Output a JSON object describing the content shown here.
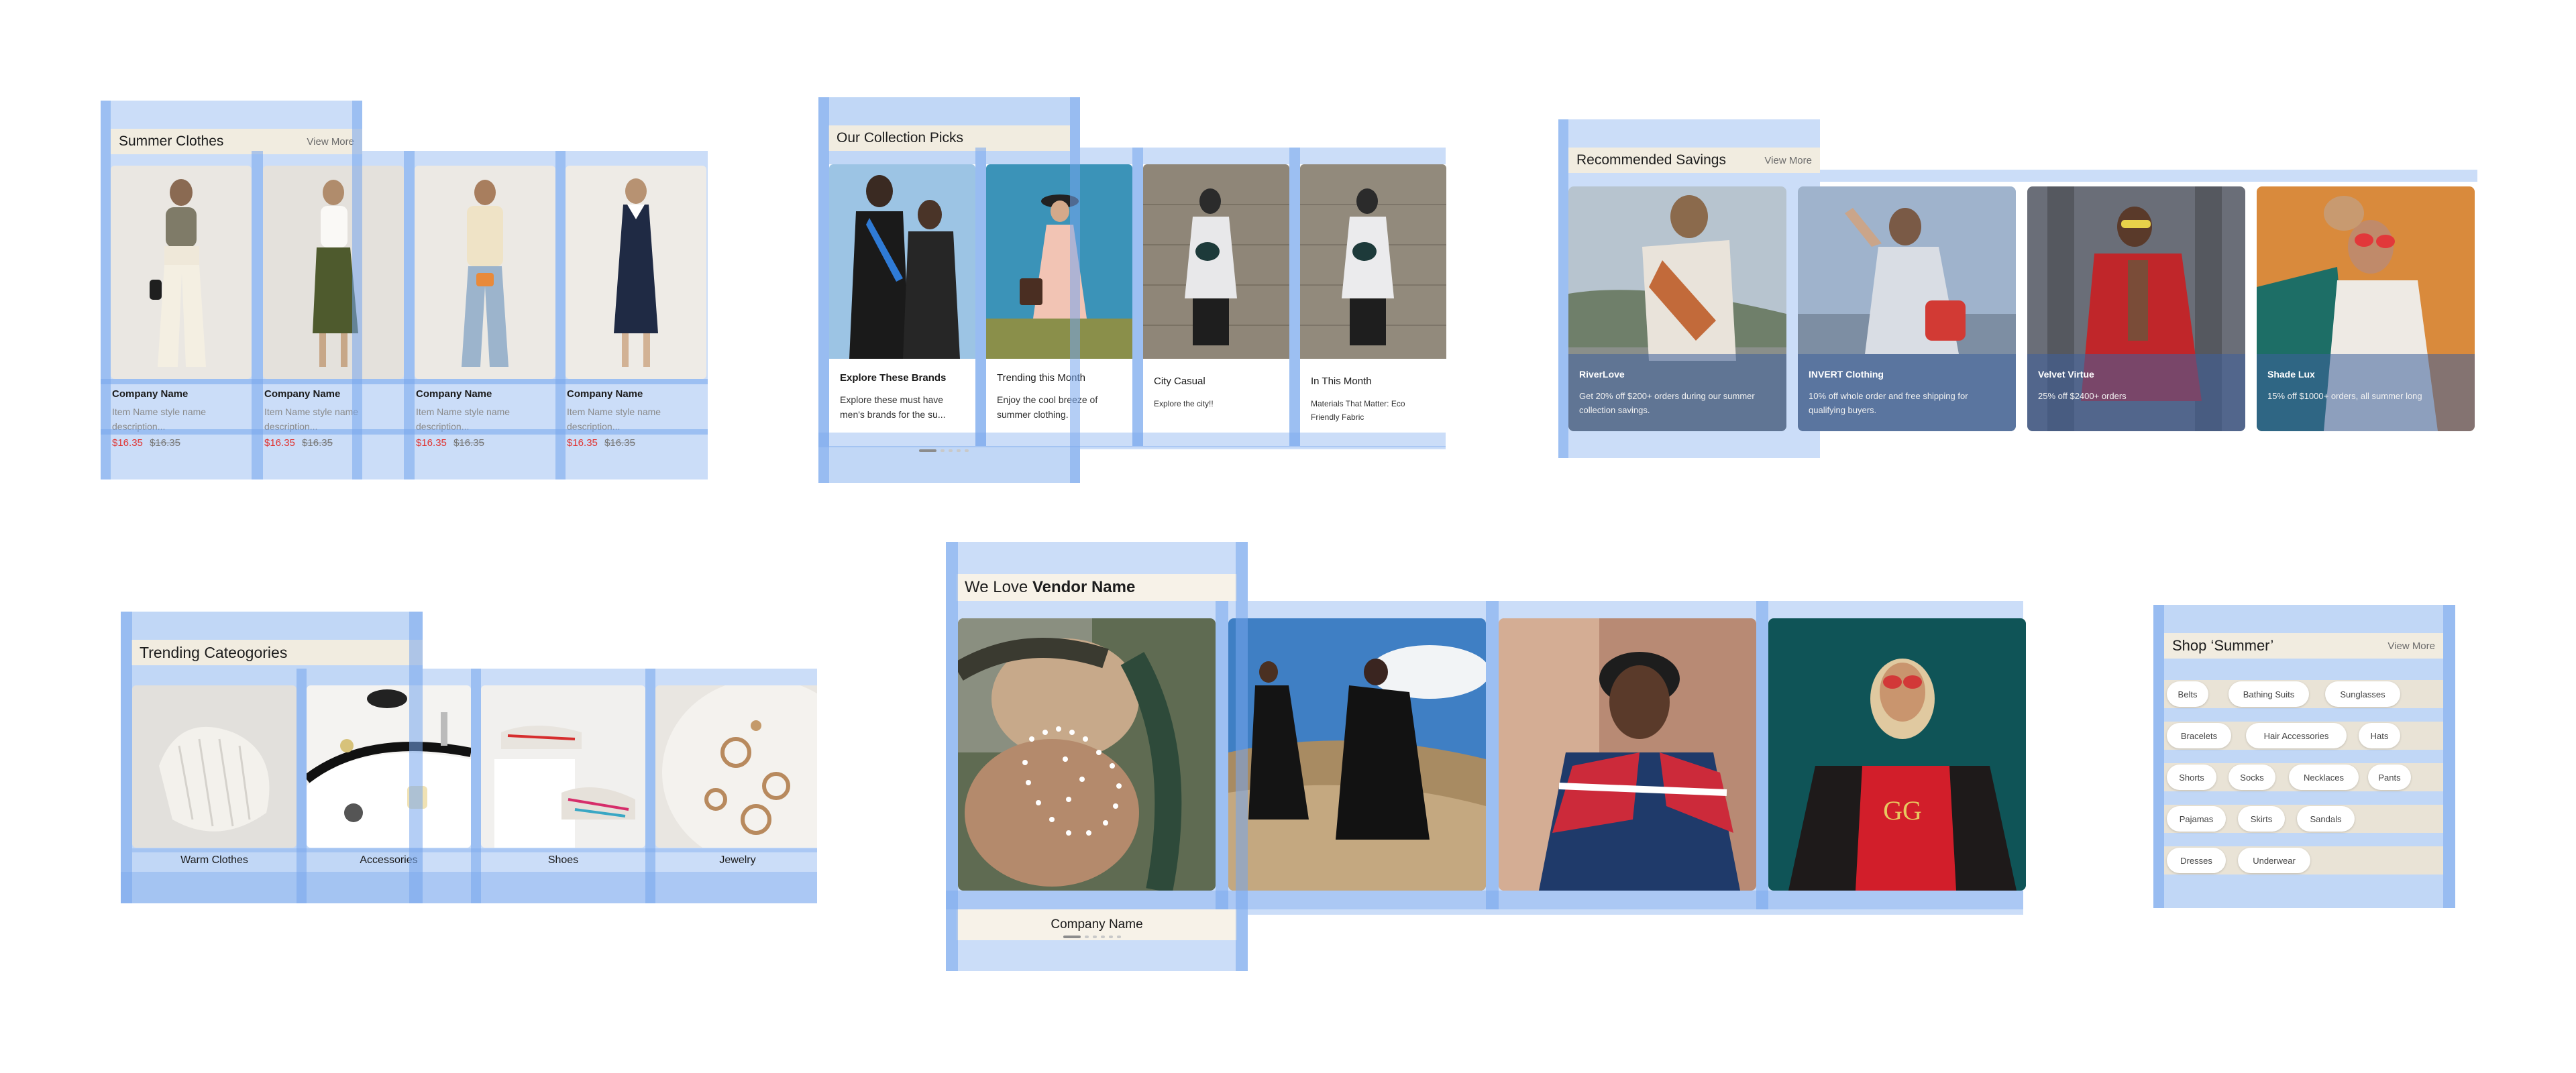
{
  "summer": {
    "title": "Summer Clothes",
    "view_more": "View More",
    "products": [
      {
        "company": "Company Name",
        "desc": "Item Name style name description...",
        "price": "$16.35",
        "old_price": "$16.35"
      },
      {
        "company": "Company Name",
        "desc": "Item Name style name description...",
        "price": "$16.35",
        "old_price": "$16.35"
      },
      {
        "company": "Company Name",
        "desc": "Item Name style name description...",
        "price": "$16.35",
        "old_price": "$16.35"
      },
      {
        "company": "Company Name",
        "desc": "Item Name style name description...",
        "price": "$16.35",
        "old_price": "$16.35"
      }
    ]
  },
  "collection": {
    "title": "Our Collection Picks",
    "cards": [
      {
        "title": "Explore These Brands",
        "desc": "Explore these must have men's brands for the su..."
      },
      {
        "title": "Trending this Month",
        "desc": "Enjoy the cool breeze of summer clothing."
      },
      {
        "title": "City Casual",
        "desc": "Explore the city!!"
      },
      {
        "title": "In This Month",
        "desc": "Materials That Matter: Eco Friendly Fabric"
      }
    ]
  },
  "savings": {
    "title": "Recommended Savings",
    "view_more": "View More",
    "cards": [
      {
        "brand": "RiverLove",
        "offer": "Get 20% off $200+ orders during our summer collection savings."
      },
      {
        "brand": "INVERT Clothing",
        "offer": "10% off whole order and free shipping for qualifying buyers."
      },
      {
        "brand": "Velvet Virtue",
        "offer": "25% off $2400+ orders"
      },
      {
        "brand": "Shade Lux",
        "offer": "15% off $1000+ orders, all summer long"
      }
    ]
  },
  "trending": {
    "title": "Trending Cateogories",
    "categories": [
      "Warm Clothes",
      "Accessories",
      "Shoes",
      "Jewelry"
    ]
  },
  "vendor": {
    "title_prefix": "We Love",
    "title_bold": "Vendor Name",
    "company": "Company Name"
  },
  "shop": {
    "title": "Shop ‘Summer’",
    "view_more": "View More",
    "chips": [
      [
        "Belts",
        "Bathing Suits",
        "Sunglasses"
      ],
      [
        "Bracelets",
        "Hair Accessories",
        "Hats"
      ],
      [
        "Shorts",
        "Socks",
        "Necklaces",
        "Pants"
      ],
      [
        "Pajamas",
        "Skirts",
        "Sandals"
      ],
      [
        "Dresses",
        "Underwear"
      ]
    ]
  },
  "colors": {
    "sale_price": "#e0322f",
    "overlay": "#76a6ec",
    "header_bg": "#f1ece0"
  }
}
